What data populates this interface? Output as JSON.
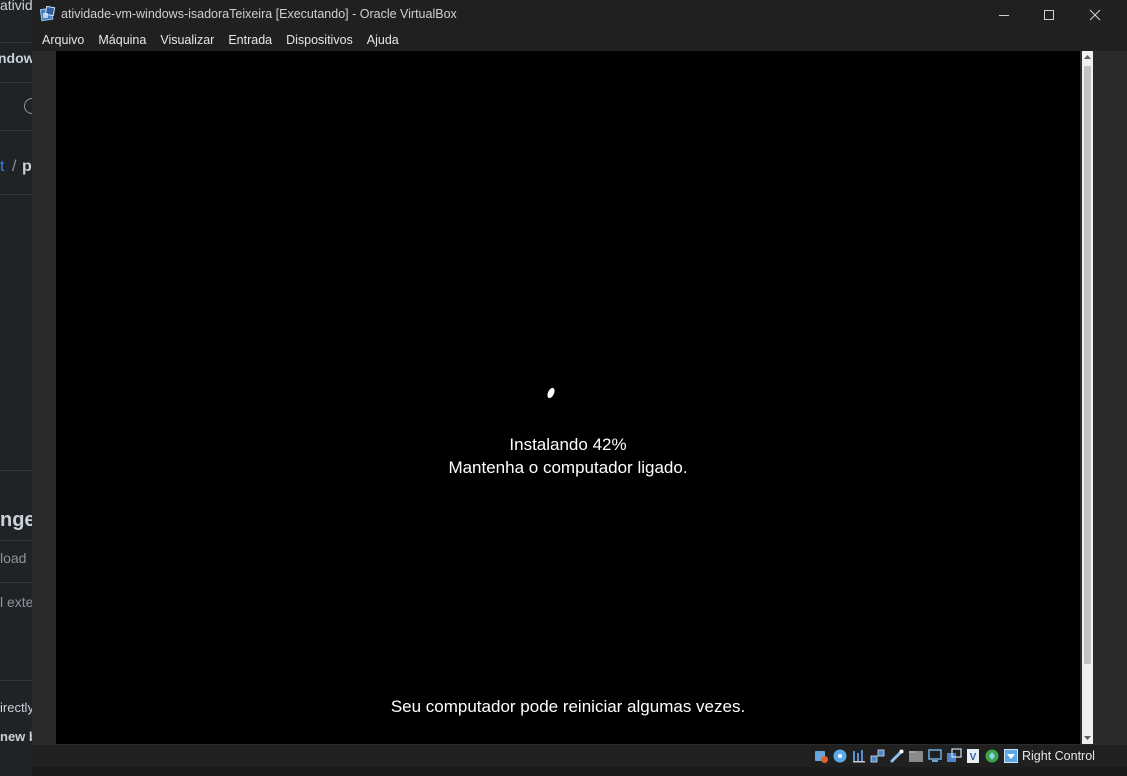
{
  "background_app": {
    "fragments": [
      "ativid",
      "ndow",
      "t",
      "/",
      "p",
      "nge",
      "load",
      "l exte",
      "irectly",
      "new b"
    ]
  },
  "window": {
    "title": "atividade-vm-windows-isadoraTeixeira [Executando] - Oracle VirtualBox",
    "app_icon": "virtualbox-icon",
    "controls": [
      "minimize-icon",
      "maximize-icon",
      "close-icon"
    ]
  },
  "menu": {
    "items": [
      {
        "label": "Arquivo"
      },
      {
        "label": "Máquina"
      },
      {
        "label": "Visualizar"
      },
      {
        "label": "Entrada"
      },
      {
        "label": "Dispositivos"
      },
      {
        "label": "Ajuda"
      }
    ]
  },
  "vm_screen": {
    "installing_label": "Instalando  42%",
    "installing_percent": 42,
    "keep_on_text": "Mantenha o computador ligado.",
    "restart_text": "Seu computador pode reiniciar algumas vezes.",
    "background": "#000000",
    "text_color": "#ffffff"
  },
  "status_bar": {
    "icons": [
      "hard-disk-icon",
      "optical-drive-icon",
      "audio-icon",
      "network-icon",
      "usb-icon",
      "shared-folders-icon",
      "display-icon",
      "recording-icon",
      "virtualization-icon",
      "mouse-integration-icon",
      "keyboard-capture-icon"
    ],
    "host_key_label": "Right Control"
  }
}
